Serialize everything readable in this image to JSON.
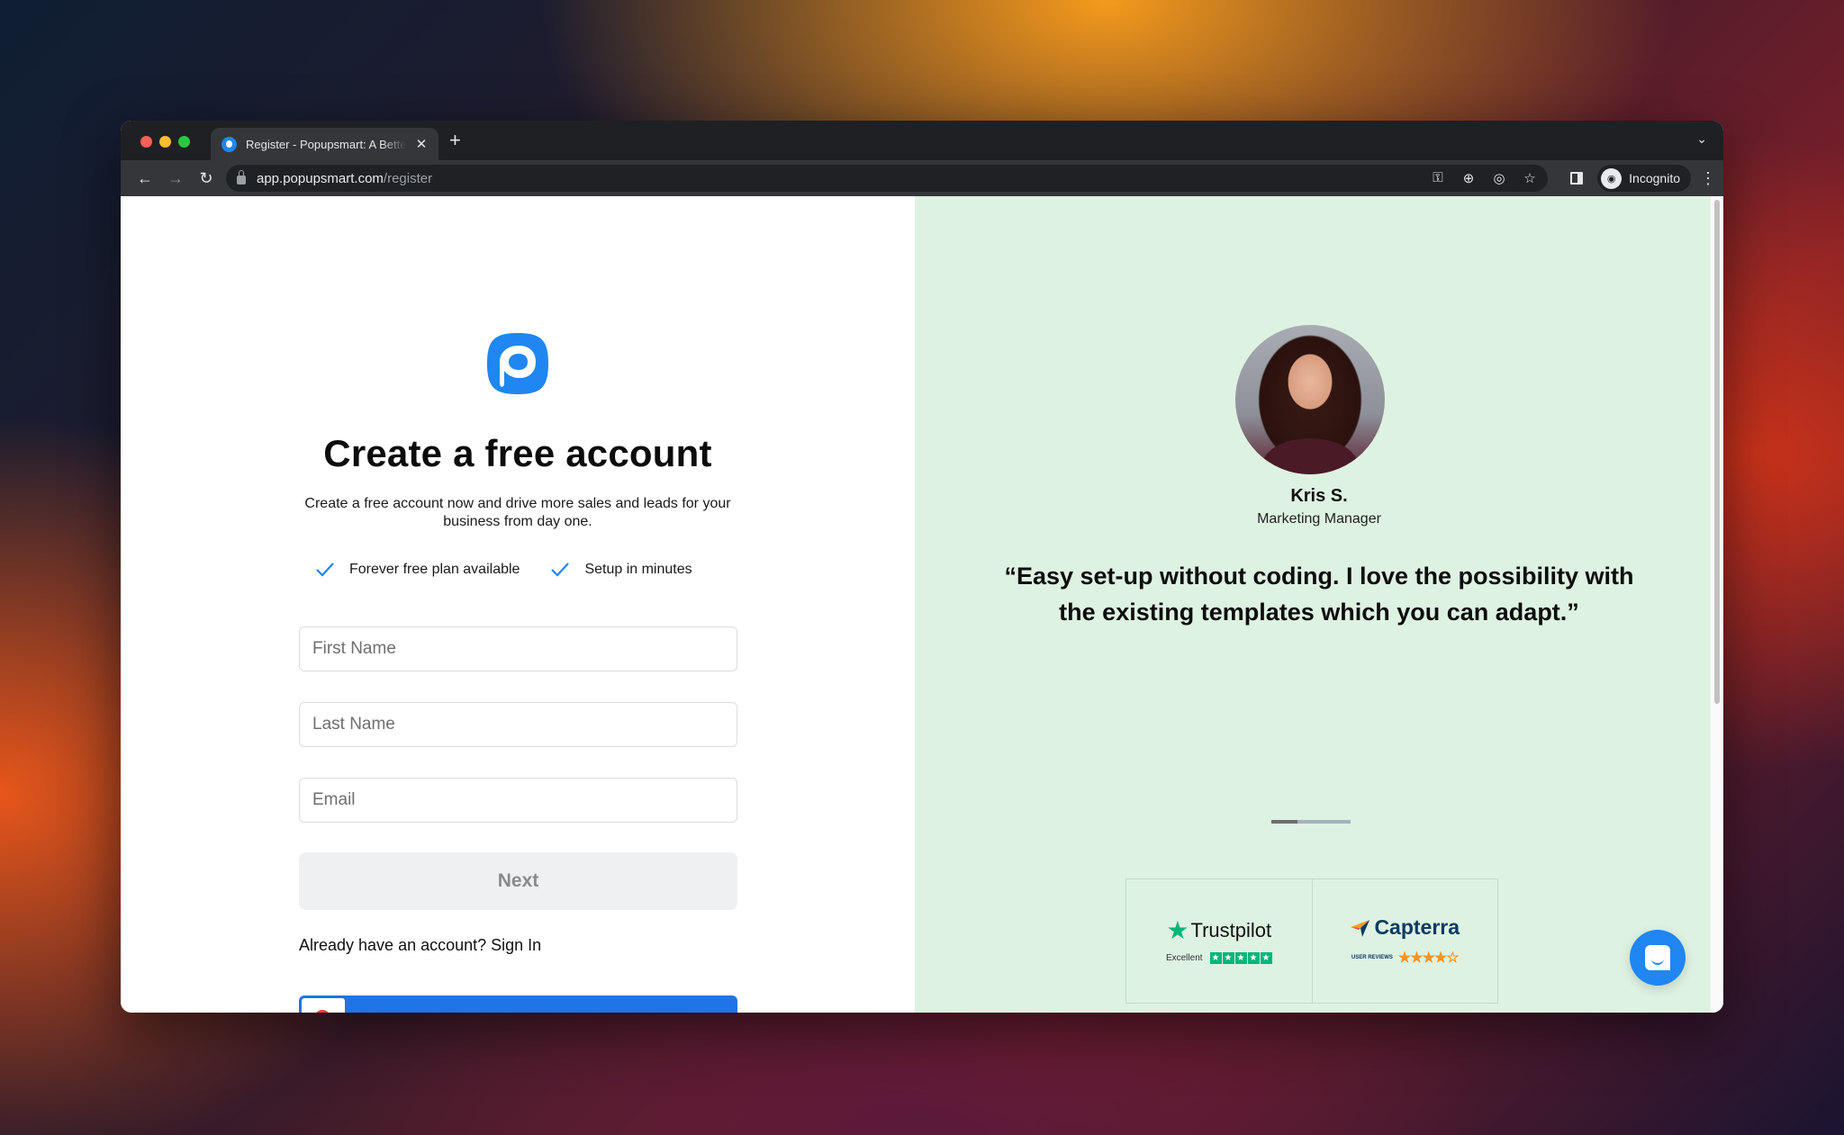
{
  "browser": {
    "tab": {
      "title": "Register - Popupsmart: A Better Way to Build Popups",
      "close_icon": "✕"
    },
    "new_tab_icon": "+",
    "tab_list_icon": "⌄",
    "nav": {
      "back": "←",
      "forward": "→",
      "reload": "↻"
    },
    "url": {
      "host": "app.popupsmart.com",
      "path": "/register"
    },
    "omnibox_icons": {
      "key": "⚿",
      "zoom": "⊕",
      "tracking": "◎",
      "bookmark": "☆"
    },
    "profile": {
      "label": "Incognito",
      "icon": "◉"
    },
    "menu_icon": "⋮"
  },
  "signup": {
    "heading": "Create a free account",
    "subtitle": "Create a free account now and drive more sales and leads for your business from day one.",
    "features": [
      "Forever free plan available",
      "Setup in minutes"
    ],
    "fields": {
      "first_name": {
        "placeholder": "First Name",
        "value": ""
      },
      "last_name": {
        "placeholder": "Last Name",
        "value": ""
      },
      "email": {
        "placeholder": "Email",
        "value": ""
      }
    },
    "next_label": "Next",
    "signin_prompt": "Already have an account? Sign In",
    "brand_color": "#1f86f2"
  },
  "testimonial": {
    "name": "Kris S.",
    "role": "Marketing Manager",
    "quote": "“Easy set-up without coding. I love the possibility with the existing templates which you can adapt.”",
    "carousel": {
      "current": 1,
      "total": 3
    },
    "background_color": "#def2e2"
  },
  "badges": {
    "trustpilot": {
      "name": "Trustpilot",
      "rating_label": "Excellent",
      "stars": 5
    },
    "capterra": {
      "name": "Capterra",
      "rating_label": "USER REVIEWS",
      "stars": 4.5
    }
  }
}
